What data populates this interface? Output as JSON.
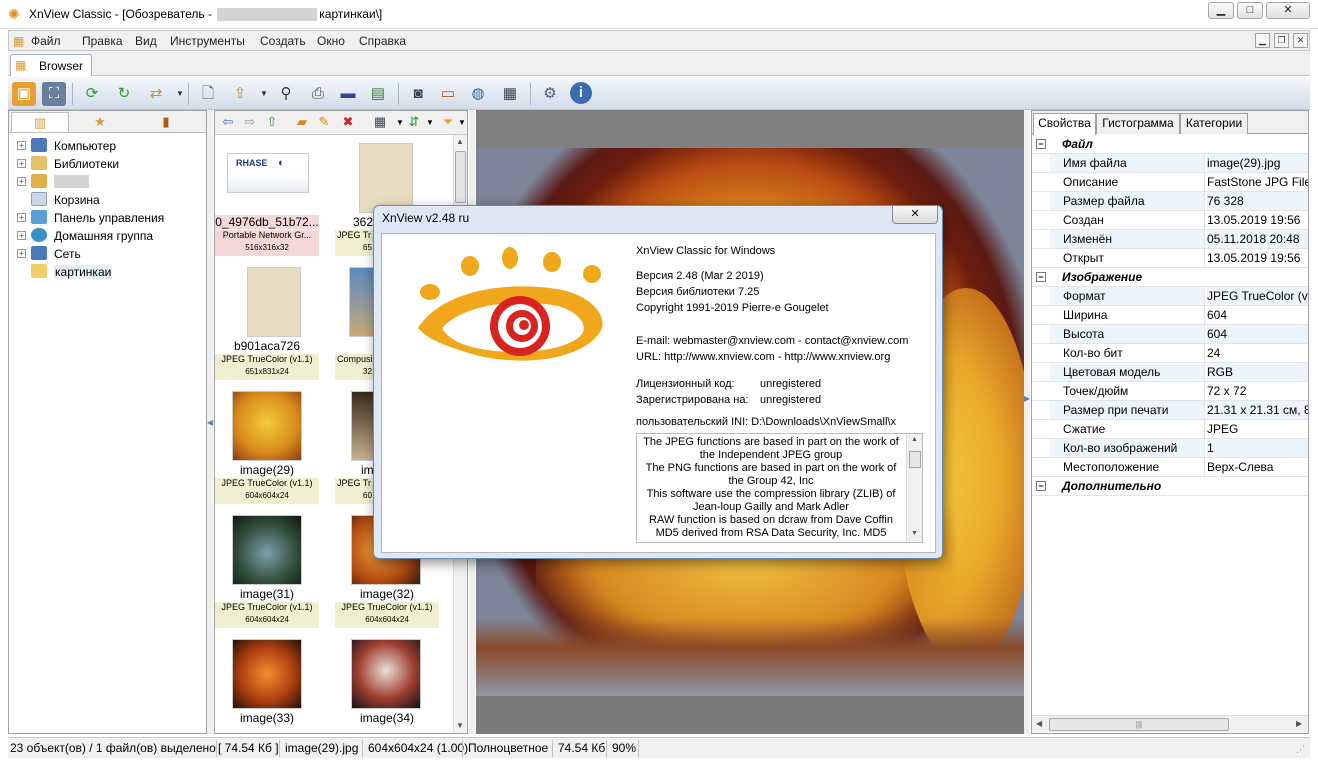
{
  "window": {
    "title_prefix": "XnView Classic - [Обозреватель - ",
    "title_suffix": "картинкаи\\]",
    "min_label": "▁",
    "max_label": "□",
    "close_label": "✕"
  },
  "menu": {
    "items": [
      "Файл",
      "Правка",
      "Вид",
      "Инструменты",
      "Создать",
      "Окно",
      "Справка"
    ]
  },
  "tabs": {
    "browser": "Browser"
  },
  "tree": {
    "items": [
      "Компьютер",
      "Библиотеки",
      "",
      "Корзина",
      "Панель управления",
      "Домашняя группа",
      "Сеть",
      "картинкаи"
    ]
  },
  "thumbnails": [
    {
      "name": "0_4976db_51b72...",
      "format": "Portable Network Gr...",
      "dims": "516x316x32"
    },
    {
      "name": "362",
      "format": "JPEG Tr",
      "dims": "65"
    },
    {
      "name": "b901aca726",
      "format": "JPEG TrueColor (v1.1)",
      "dims": "651x831x24"
    },
    {
      "name": "g",
      "format": "Compusi",
      "dims": "32"
    },
    {
      "name": "image(29)",
      "format": "JPEG TrueColor (v1.1)",
      "dims": "604x604x24"
    },
    {
      "name": "im",
      "format": "JPEG Tr",
      "dims": "60"
    },
    {
      "name": "image(31)",
      "format": "JPEG TrueColor (v1.1)",
      "dims": "604x604x24"
    },
    {
      "name": "image(32)",
      "format": "JPEG TrueColor (v1.1)",
      "dims": "604x604x24"
    },
    {
      "name": "image(33)",
      "format": "",
      "dims": ""
    },
    {
      "name": "image(34)",
      "format": "",
      "dims": ""
    }
  ],
  "properties": {
    "tabs": [
      "Свойства",
      "Гистограмма",
      "Категории"
    ],
    "categories": {
      "file": "Файл",
      "image": "Изображение",
      "extra": "Дополнительно"
    },
    "file_rows": [
      {
        "name": "Имя файла",
        "value": "image(29).jpg"
      },
      {
        "name": "Описание",
        "value": "FastStone JPG File"
      },
      {
        "name": "Размер файла",
        "value": "76 328"
      },
      {
        "name": "Создан",
        "value": "13.05.2019 19:56"
      },
      {
        "name": "Изменён",
        "value": "05.11.2018 20:48"
      },
      {
        "name": "Открыт",
        "value": "13.05.2019 19:56"
      }
    ],
    "image_rows": [
      {
        "name": "Формат",
        "value": "JPEG TrueColor (v1."
      },
      {
        "name": "Ширина",
        "value": "604"
      },
      {
        "name": "Высота",
        "value": "604"
      },
      {
        "name": "Кол-во бит",
        "value": "24"
      },
      {
        "name": "Цветовая модель",
        "value": "RGB"
      },
      {
        "name": "Точек/дюйм",
        "value": "72 x 72"
      },
      {
        "name": "Размер при печати",
        "value": "21.31 x 21.31 см, 8.3"
      },
      {
        "name": "Сжатие",
        "value": "JPEG"
      },
      {
        "name": "Кол-во изображений",
        "value": "1"
      },
      {
        "name": "Местоположение",
        "value": "Верх-Слева"
      }
    ]
  },
  "status": {
    "count": "23 объект(ов) / 1 файл(ов) выделено",
    "size": "[ 74.54 Кб ]",
    "file": "image(29).jpg",
    "dims": "604x604x24 (1.00)",
    "color": "Полноцветное",
    "filesize": "74.54 Кб",
    "zoom": "90%"
  },
  "about": {
    "title": "XnView v2.48 ru",
    "close_label": "✕",
    "product": "XnView Classic for Windows",
    "version": "Версия 2.48 (Mar  2 2019)",
    "lib_version": "Версия библиотеки 7.25",
    "copyright": "Copyright 1991-2019 Pierre-e Gougelet",
    "email": "E-mail: webmaster@xnview.com - contact@xnview.com",
    "url": "URL: http://www.xnview.com - http://www.xnview.org",
    "license_label": "Лицензионный код:",
    "license_value": "unregistered",
    "registered_label": "Зарегистрирована на:",
    "registered_value": "unregistered",
    "ini": "пользовательский INI: D:\\Downloads\\XnViewSmall\\x",
    "credits": [
      "The JPEG functions are based in part on the work of",
      "the Independent JPEG group",
      "The PNG functions are based in part on the work of",
      "the Group 42, Inc",
      "This software use the compression library (ZLIB) of",
      "Jean-loup Gailly and Mark Adler",
      "RAW function is based on dcraw from Dave Coffin",
      "MD5 derived from RSA Data Security, Inc. MD5"
    ]
  },
  "colors": {
    "accent": "#e88a1a",
    "logo_red": "#d9231f",
    "toolbar_blue": "#d3dcea"
  }
}
